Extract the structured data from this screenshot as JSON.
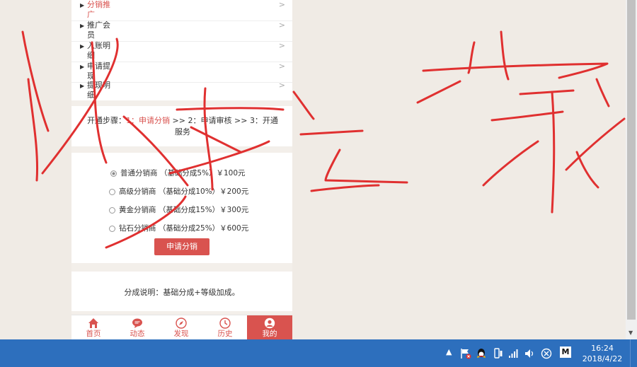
{
  "menu": {
    "items": [
      {
        "label": "分销推广",
        "active": true
      },
      {
        "label": "推广会员",
        "active": false
      },
      {
        "label": "入账明细",
        "active": false
      },
      {
        "label": "申请提现",
        "active": false
      },
      {
        "label": "提现明细",
        "active": false
      }
    ],
    "chevron": ">"
  },
  "steps": {
    "prefix": "开通步骤：",
    "step1": "1：申请分销",
    "sep1": " >> ",
    "step2": "2：申请审核",
    "sep2": " >> ",
    "step3": "3：开通服务"
  },
  "levels": {
    "options": [
      {
        "label": "普通分销商 （基础分成5%）￥100元",
        "selected": true
      },
      {
        "label": "高级分销商 （基础分成10%）￥200元",
        "selected": false
      },
      {
        "label": "黄金分销商 （基础分成15%）￥300元",
        "selected": false
      },
      {
        "label": "钻石分销商 （基础分成25%）￥600元",
        "selected": false
      }
    ],
    "apply_button": "申请分销"
  },
  "note": {
    "text": "分成说明：基础分成+等级加成。"
  },
  "tabbar": {
    "tabs": [
      {
        "label": "首页",
        "icon": "home-icon",
        "active": false
      },
      {
        "label": "动态",
        "icon": "chat-icon",
        "active": false
      },
      {
        "label": "发现",
        "icon": "compass-icon",
        "active": false
      },
      {
        "label": "历史",
        "icon": "clock-icon",
        "active": false
      },
      {
        "label": "我的",
        "icon": "user-icon",
        "active": true
      }
    ]
  },
  "taskbar": {
    "time": "16:24",
    "date": "2018/4/22",
    "tray_m": "M"
  },
  "colors": {
    "accent": "#d9534f",
    "scribble": "#e03030",
    "taskbar": "#2d6fbd"
  }
}
